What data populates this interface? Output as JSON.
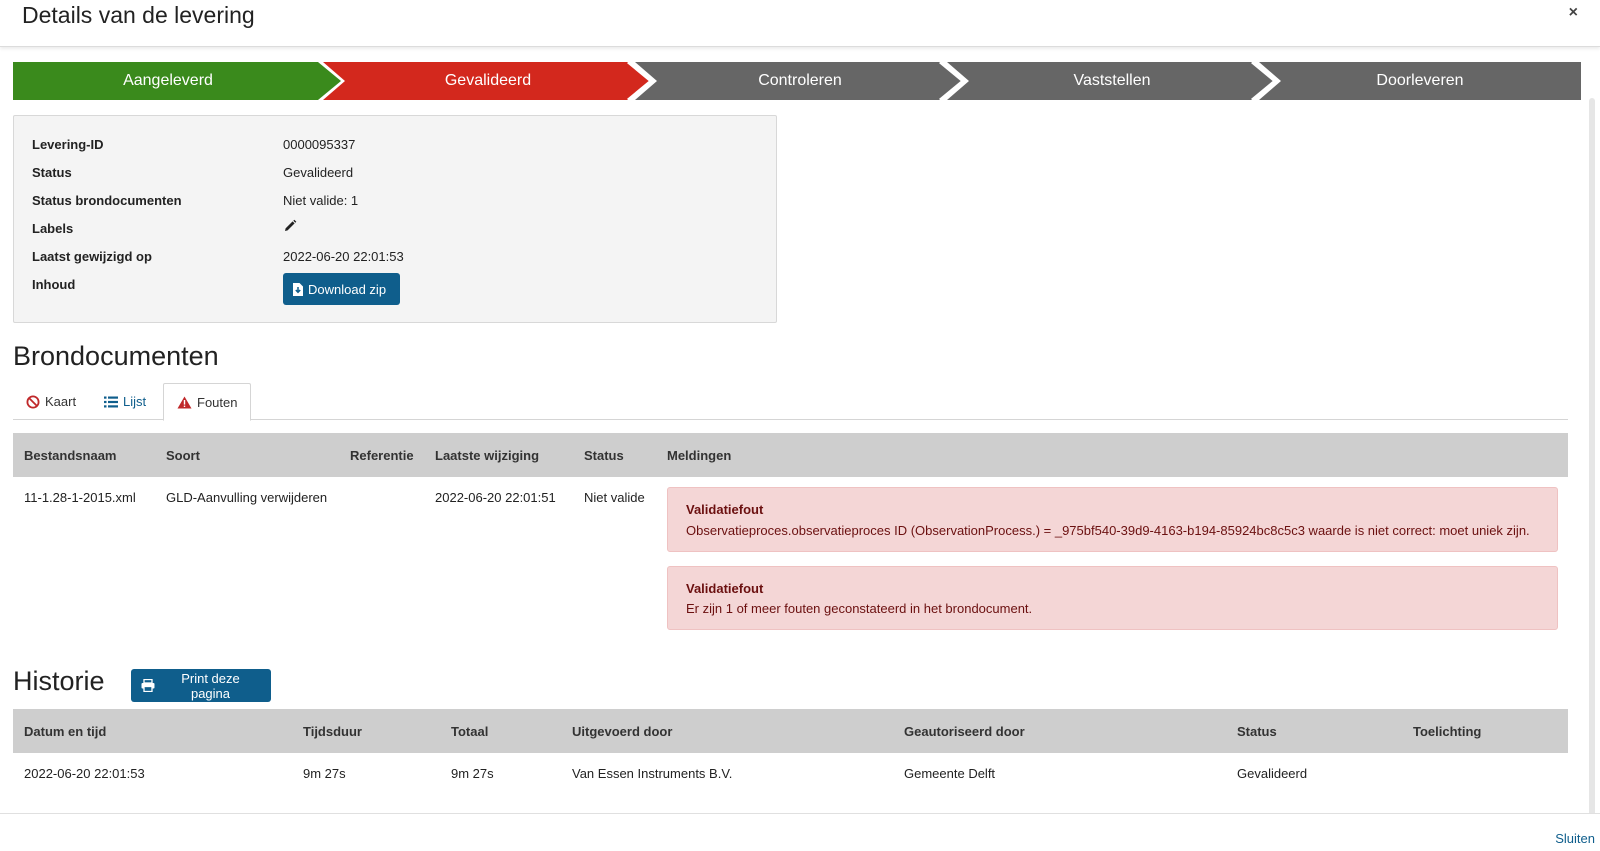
{
  "modal": {
    "title": "Details van de levering",
    "close_label": "×"
  },
  "steps": [
    {
      "label": "Aangeleverd",
      "color": "#3a8a1c"
    },
    {
      "label": "Gevalideerd",
      "color": "#d3281d"
    },
    {
      "label": "Controleren",
      "color": "#666666"
    },
    {
      "label": "Vaststellen",
      "color": "#666666"
    },
    {
      "label": "Doorleveren",
      "color": "#666666"
    }
  ],
  "info": {
    "levering_id": {
      "label": "Levering-ID",
      "value": "0000095337"
    },
    "status": {
      "label": "Status",
      "value": "Gevalideerd"
    },
    "status_bron": {
      "label": "Status brondocumenten",
      "value": "Niet valide: 1"
    },
    "labels": {
      "label": "Labels",
      "icon": "pencil-icon"
    },
    "laatst": {
      "label": "Laatst gewijzigd op",
      "value": "2022-06-20 22:01:53"
    },
    "inhoud": {
      "label": "Inhoud",
      "button": "Download zip",
      "icon": "file-download-icon"
    }
  },
  "brondocumenten": {
    "heading": "Brondocumenten",
    "tabs": [
      {
        "label": "Kaart",
        "icon": "ban-icon"
      },
      {
        "label": "Lijst",
        "icon": "list-icon"
      },
      {
        "label": "Fouten",
        "icon": "warning-icon"
      }
    ],
    "columns": [
      "Bestandsnaam",
      "Soort",
      "Referentie",
      "Laatste wijziging",
      "Status",
      "Meldingen"
    ],
    "row": {
      "bestandsnaam": "11-1.28-1-2015.xml",
      "soort": "GLD-Aanvulling verwijderen",
      "referentie": "",
      "laatste_wijziging": "2022-06-20 22:01:51",
      "status": "Niet valide"
    },
    "meldingen": [
      {
        "title": "Validatiefout",
        "message": "Observatieproces.observatieproces ID (ObservationProcess.) = _975bf540-39d9-4163-b194-85924bc8c5c3 waarde is niet correct: moet uniek zijn."
      },
      {
        "title": "Validatiefout",
        "message": "Er zijn 1 of meer fouten geconstateerd in het brondocument."
      }
    ]
  },
  "historie": {
    "heading": "Historie",
    "print_button": "Print deze pagina",
    "columns": [
      "Datum en tijd",
      "Tijdsduur",
      "Totaal",
      "Uitgevoerd door",
      "Geautoriseerd door",
      "Status",
      "Toelichting"
    ],
    "row": {
      "datum": "2022-06-20 22:01:53",
      "tijdsduur": "9m 27s",
      "totaal": "9m 27s",
      "uitgevoerd": "Van Essen Instruments B.V.",
      "geautoriseerd": "Gemeente Delft",
      "status": "Gevalideerd",
      "toelichting": ""
    }
  },
  "footer": {
    "close_link": "Sluiten"
  }
}
